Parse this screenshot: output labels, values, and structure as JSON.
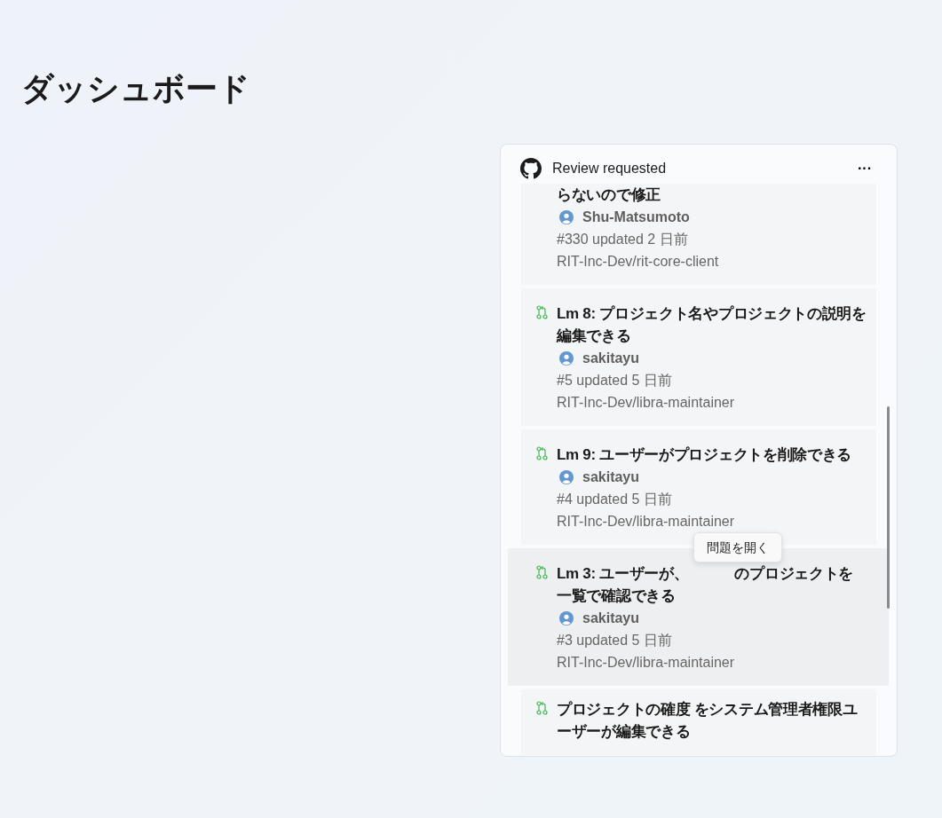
{
  "page": {
    "title": "ダッシュボード"
  },
  "widget": {
    "title": "Review requested",
    "menu": "···",
    "items": [
      {
        "kind": "cut",
        "title_parts": [
          "らないので修正"
        ],
        "author": "Shu-Matsumoto",
        "meta": "#330 updated 2 日前",
        "repo": "RIT-Inc-Dev/rit-core-client",
        "hovered": false
      },
      {
        "kind": "pr",
        "title_parts": [
          "Lm 8: プロジェクト名やプロジェクトの説明を編集できる"
        ],
        "author": "sakitayu",
        "meta": "#5 updated 5 日前",
        "repo": "RIT-Inc-Dev/libra-maintainer",
        "hovered": false
      },
      {
        "kind": "pr",
        "title_parts": [
          "Lm 9: ユーザーがプロジェクトを削除できる"
        ],
        "author": "sakitayu",
        "meta": "#4 updated 5 日前",
        "repo": "RIT-Inc-Dev/libra-maintainer",
        "hovered": false
      },
      {
        "kind": "pr",
        "title_parts": [
          "Lm 3: ユーザーが、",
          "のプロジェクトを一覧で確認できる"
        ],
        "author": "sakitayu",
        "meta": "#3 updated 5 日前",
        "repo": "RIT-Inc-Dev/libra-maintainer",
        "hovered": true,
        "tooltip": "問題を開く"
      },
      {
        "kind": "pr",
        "title_parts": [
          "プロジェクトの確度 をシステム管理者権限ユーザーが編集できる"
        ],
        "hovered": false
      }
    ]
  }
}
